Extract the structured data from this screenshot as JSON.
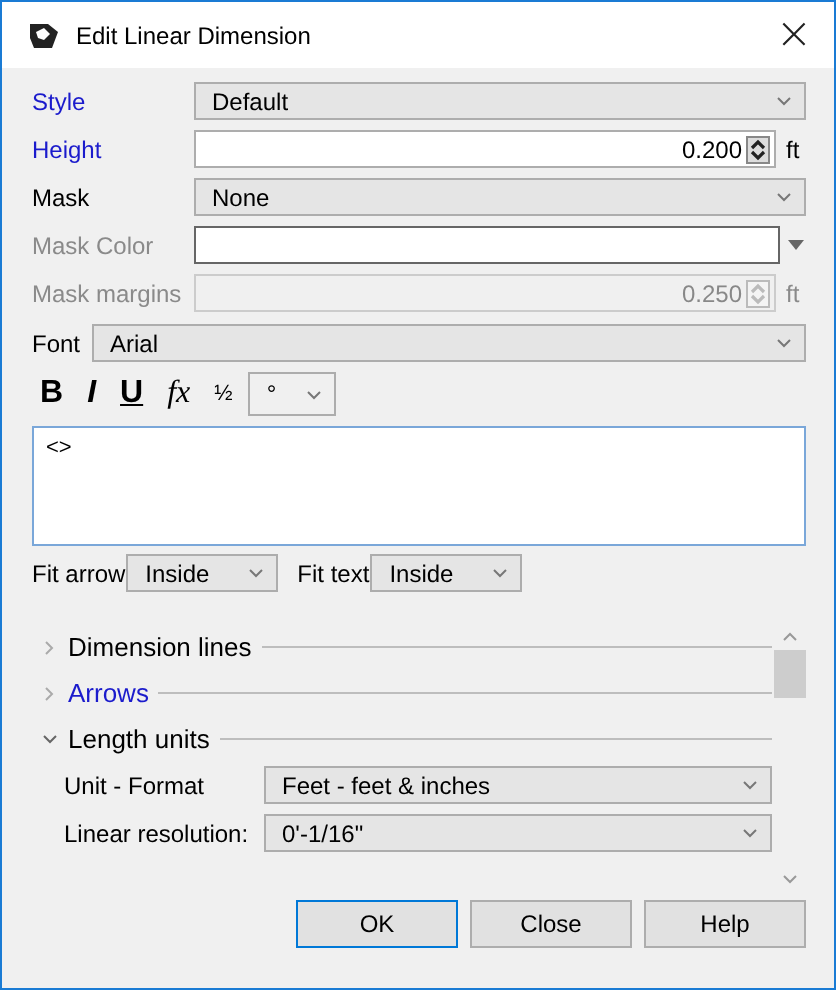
{
  "window": {
    "title": "Edit Linear Dimension",
    "close": "×"
  },
  "fields": [
    {
      "kind": "dropdown",
      "label": "Style",
      "highlighted": true,
      "disabled": false,
      "value": "Default"
    },
    {
      "kind": "number",
      "label": "Height",
      "highlighted": true,
      "disabled": false,
      "value": "0.200",
      "unit": "ft"
    },
    {
      "kind": "dropdown",
      "label": "Mask",
      "highlighted": false,
      "disabled": false,
      "value": "None"
    },
    {
      "kind": "color",
      "label": "Mask Color",
      "highlighted": false,
      "disabled": true
    },
    {
      "kind": "number",
      "label": "Mask margins",
      "highlighted": false,
      "disabled": true,
      "value": "0.250",
      "unit": "ft"
    }
  ],
  "font": {
    "label": "Font",
    "value": "Arial"
  },
  "format_toolbar": {
    "bold": "B",
    "italic": "I",
    "underline": "U",
    "function": "fx",
    "fraction": "½",
    "symbol": "°"
  },
  "text": "<>",
  "fit": [
    {
      "label": "Fit arrow",
      "value": "Inside"
    },
    {
      "label": "Fit text",
      "value": "Inside"
    }
  ],
  "sections": [
    {
      "title": "Dimension lines",
      "expanded": false,
      "highlighted": false
    },
    {
      "title": "Arrows",
      "expanded": false,
      "highlighted": true
    },
    {
      "title": "Length units",
      "expanded": true,
      "highlighted": false,
      "rows": [
        {
          "kind": "dropdown",
          "label": "Unit - Format",
          "value": "Feet - feet & inches"
        },
        {
          "kind": "dropdown",
          "label": "Linear resolution:",
          "value": "0'-1/16\""
        }
      ]
    }
  ],
  "buttons": [
    {
      "label": "OK",
      "default": true
    },
    {
      "label": "Close",
      "default": false
    },
    {
      "label": "Help",
      "default": false
    }
  ]
}
